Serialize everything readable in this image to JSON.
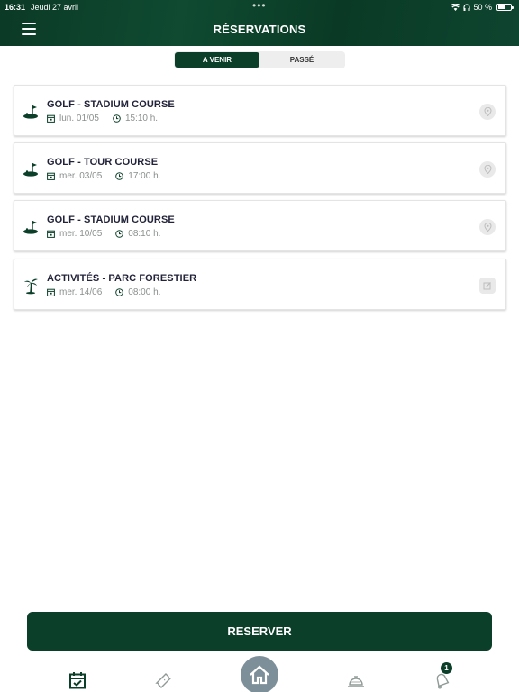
{
  "status_bar": {
    "time": "16:31",
    "date": "Jeudi 27 avril",
    "battery": "50 %"
  },
  "header": {
    "title": "RÉSERVATIONS"
  },
  "tabs": [
    {
      "label": "A VENIR",
      "active": true
    },
    {
      "label": "PASSÉ",
      "active": false
    }
  ],
  "reservations": [
    {
      "title": "GOLF - STADIUM COURSE",
      "date": "lun. 01/05",
      "time": "15:10 h.",
      "icon": "golf-icon",
      "action_icon": "location-pin-icon"
    },
    {
      "title": "GOLF - TOUR COURSE",
      "date": "mer. 03/05",
      "time": "17:00 h.",
      "icon": "golf-icon",
      "action_icon": "location-pin-icon"
    },
    {
      "title": "GOLF - STADIUM COURSE",
      "date": "mer. 10/05",
      "time": "08:10 h.",
      "icon": "golf-icon",
      "action_icon": "location-pin-icon"
    },
    {
      "title": "ACTIVITÉS - PARC FORESTIER",
      "date": "mer. 14/06",
      "time": "08:00 h.",
      "icon": "palm-tree-icon",
      "action_icon": "edit-icon"
    }
  ],
  "reserve_button": {
    "label": "RESERVER"
  },
  "tab_bar": {
    "items": [
      "calendar-check-icon",
      "ticket-icon",
      "home-icon",
      "service-bell-icon",
      "bell-icon"
    ],
    "notification_count": "1"
  },
  "colors": {
    "brand_green": "#0b3f29",
    "home_button": "#7d8f98",
    "muted_text": "#8a8f8c"
  }
}
